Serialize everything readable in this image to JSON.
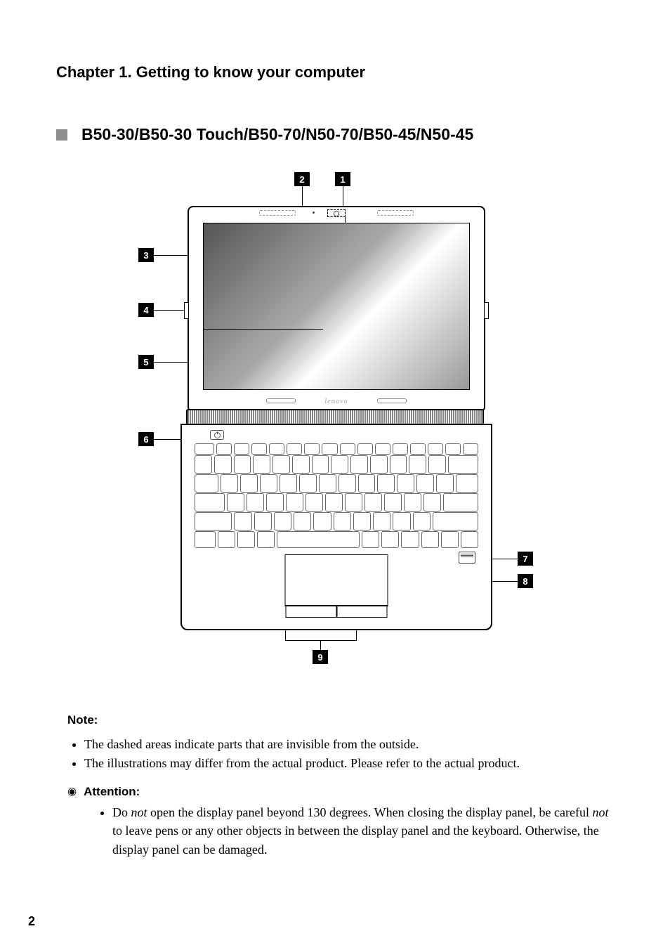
{
  "chapter_title": "Chapter 1. Getting to know your computer",
  "subheading": "B50-30/B50-30 Touch/B50-70/N50-70/B50-45/N50-45",
  "callouts": {
    "c1": "1",
    "c2": "2",
    "c3": "3",
    "c4": "4",
    "c5": "5",
    "c6": "6",
    "c7": "7",
    "c8": "8",
    "c9": "9"
  },
  "lid_brand": "lenovo",
  "note": {
    "title": "Note:",
    "items": [
      "The dashed areas indicate parts that are invisible from the outside.",
      "The illustrations may differ from the actual product. Please refer to the actual product."
    ]
  },
  "attention": {
    "title": "Attention:",
    "body_pre": "Do ",
    "body_not1": "not",
    "body_mid": " open the display panel beyond 130 degrees. When closing the display panel, be careful ",
    "body_not2": "not",
    "body_post": " to leave pens or any other objects in between the display panel and the keyboard. Otherwise, the display panel can be damaged."
  },
  "page_number": "2"
}
